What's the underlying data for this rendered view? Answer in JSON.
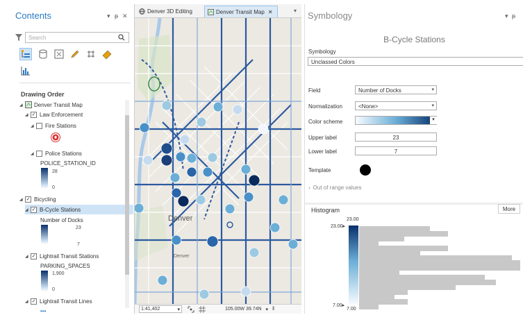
{
  "contents": {
    "title": "Contents",
    "search_placeholder": "Search",
    "drawing_order": "Drawing Order",
    "tree": {
      "map": "Denver Transit Map",
      "law_enforcement": "Law Enforcement",
      "fire_stations": "Fire Stations",
      "police_stations": "Police Stations",
      "police_field": "POLICE_STATION_ID",
      "police_max": "28",
      "police_min": "0",
      "bicycling": "Bicycling",
      "bcycle": "B-Cycle Stations",
      "bcycle_field": "Number of Docks",
      "bcycle_max": "23",
      "bcycle_min": "7",
      "lightrail_stations": "Lightrail Transit Stations",
      "parking_field": "PARKING_SPACES",
      "parking_max": "1,900",
      "parking_min": "0",
      "lightrail_lines": "Lightrail Transit Lines",
      "more": "•••"
    }
  },
  "map": {
    "tabs": [
      "Denver 3D Editing",
      "Denver Transit Map"
    ],
    "scale": "1:41,402",
    "coords": "105.00W 39.74N",
    "labels": [
      "Denver",
      "Denver"
    ]
  },
  "symbology": {
    "title": "Symbology",
    "layer": "B-Cycle Stations",
    "symbology_label": "Symbology",
    "method": "Unclassed Colors",
    "field_label": "Field",
    "field_value": "Number of Docks",
    "normalization_label": "Normalization",
    "normalization_value": "<None>",
    "color_scheme_label": "Color scheme",
    "upper_label": "Upper label",
    "upper_value": "23",
    "lower_label": "Lower label",
    "lower_value": "7",
    "template_label": "Template",
    "out_of_range": "Out of range values",
    "histogram_title": "Histogram",
    "more_label": "More",
    "hist_top": "23.00",
    "hist_top_marker": "23.00",
    "hist_bottom": "7.00",
    "hist_bottom_marker": "7.00",
    "hist_bins": [
      0.44,
      0.55,
      0.28,
      0.12,
      0.55,
      0.38,
      0.95,
      1.0,
      1.0,
      0.25,
      0.78,
      0.85,
      0.6,
      0.3,
      0.22,
      0.3,
      0.12
    ]
  }
}
